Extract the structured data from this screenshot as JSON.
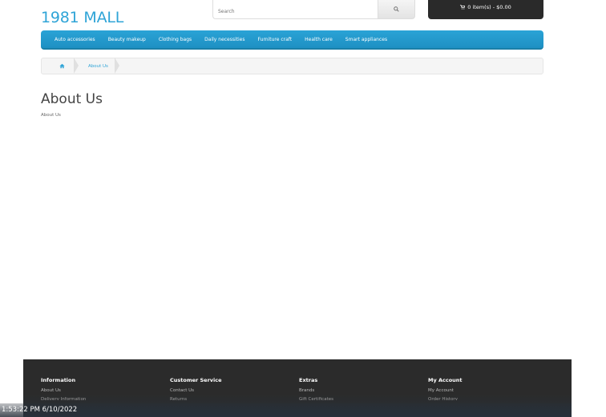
{
  "header": {
    "logo": "1981 MALL",
    "search": {
      "placeholder": "Search",
      "value": ""
    },
    "cart": {
      "label": "0 item(s) - $0.00",
      "icon": "cart-icon"
    }
  },
  "navbar": {
    "items": [
      {
        "label": "Auto accessories"
      },
      {
        "label": "Beauty makeup"
      },
      {
        "label": "Clothing bags"
      },
      {
        "label": "Daily necessities"
      },
      {
        "label": "Furniture craft"
      },
      {
        "label": "Health care"
      },
      {
        "label": "Smart appliances"
      }
    ]
  },
  "breadcrumb": {
    "home_icon": "home-icon",
    "items": [
      {
        "label": "About Us"
      }
    ]
  },
  "main": {
    "title": "About Us",
    "body": "About Us"
  },
  "footer": {
    "columns": [
      {
        "heading": "Information",
        "links": [
          "About Us",
          "Delivery Information"
        ]
      },
      {
        "heading": "Customer Service",
        "links": [
          "Contact Us",
          "Returns"
        ]
      },
      {
        "heading": "Extras",
        "links": [
          "Brands",
          "Gift Certificates"
        ]
      },
      {
        "heading": "My Account",
        "links": [
          "My Account",
          "Order History"
        ]
      }
    ]
  },
  "taskbar": {
    "clock": "1:53:22 PM 6/10/2022"
  }
}
